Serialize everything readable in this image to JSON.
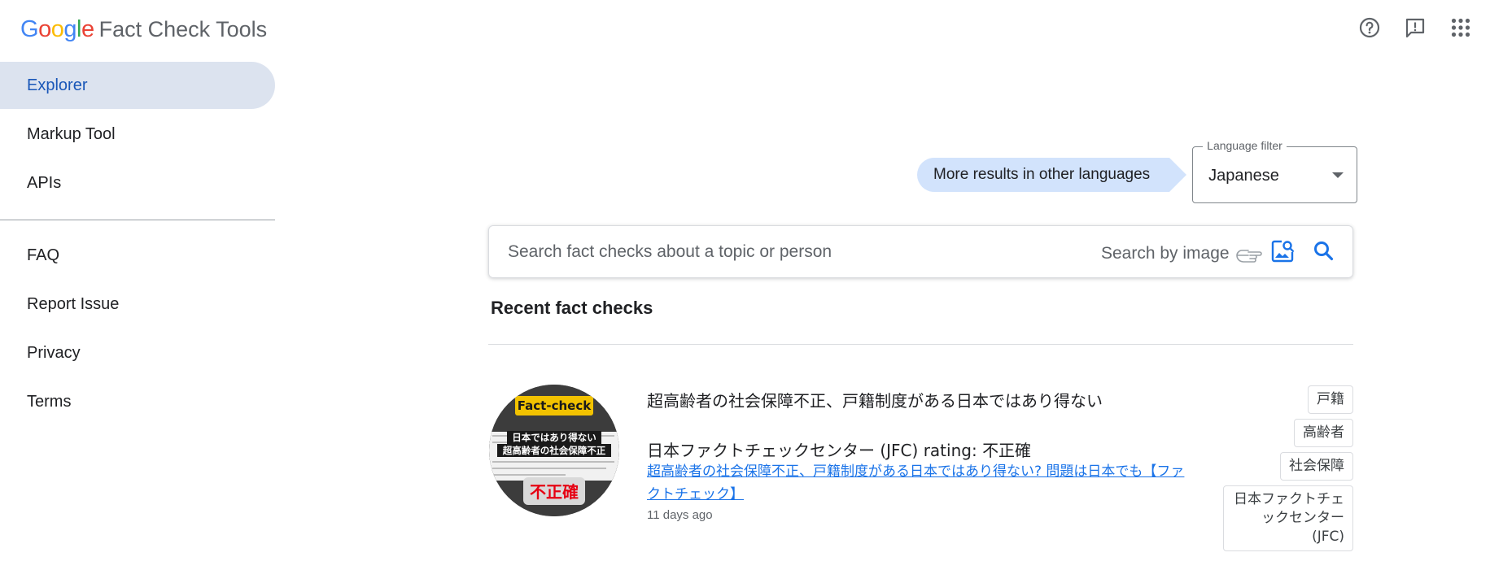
{
  "header": {
    "logo_google": "Google",
    "logo_product": "Fact Check Tools",
    "logo_colors": [
      "#4285f4",
      "#ea4335",
      "#fbbc05",
      "#4285f4",
      "#34a853",
      "#ea4335"
    ],
    "icons": [
      "help-icon",
      "feedback-icon",
      "apps-grid-icon"
    ]
  },
  "sidebar": {
    "items": [
      {
        "label": "Explorer",
        "active": true
      },
      {
        "label": "Markup Tool"
      },
      {
        "label": "APIs"
      }
    ],
    "items_secondary": [
      {
        "label": "FAQ"
      },
      {
        "label": "Report Issue"
      },
      {
        "label": "Privacy"
      },
      {
        "label": "Terms"
      }
    ]
  },
  "language": {
    "more_results": "More results in other languages",
    "filter_label": "Language filter",
    "filter_value": "Japanese"
  },
  "search": {
    "placeholder": "Search fact checks about a topic or person",
    "by_image": "Search by image"
  },
  "recent": {
    "title": "Recent fact checks",
    "items": [
      {
        "claim": "超高齢者の社会保障不正、戸籍制度がある日本ではあり得ない",
        "publisher": "日本ファクトチェックセンター (JFC)",
        "rating_label": "rating:",
        "rating": "不正確",
        "link": "超高齢者の社会保障不正、戸籍制度がある日本ではあり得ない? 問題は日本でも【ファクトチェック】",
        "date": "11 days ago",
        "thumb": {
          "badge": "Fact-check",
          "line1": "日本ではあり得ない",
          "line2": "超高齢者の社会保障不正",
          "verdict": "不正確"
        },
        "tags": [
          "戸籍",
          "高齢者",
          "社会保障",
          "日本ファクトチェックセンター (JFC)"
        ]
      }
    ]
  },
  "colors": {
    "active_bg": "#dce3ef",
    "active_text": "#1a57b8",
    "link": "#1a73e8",
    "more_results_bg": "#d2e3fc"
  }
}
